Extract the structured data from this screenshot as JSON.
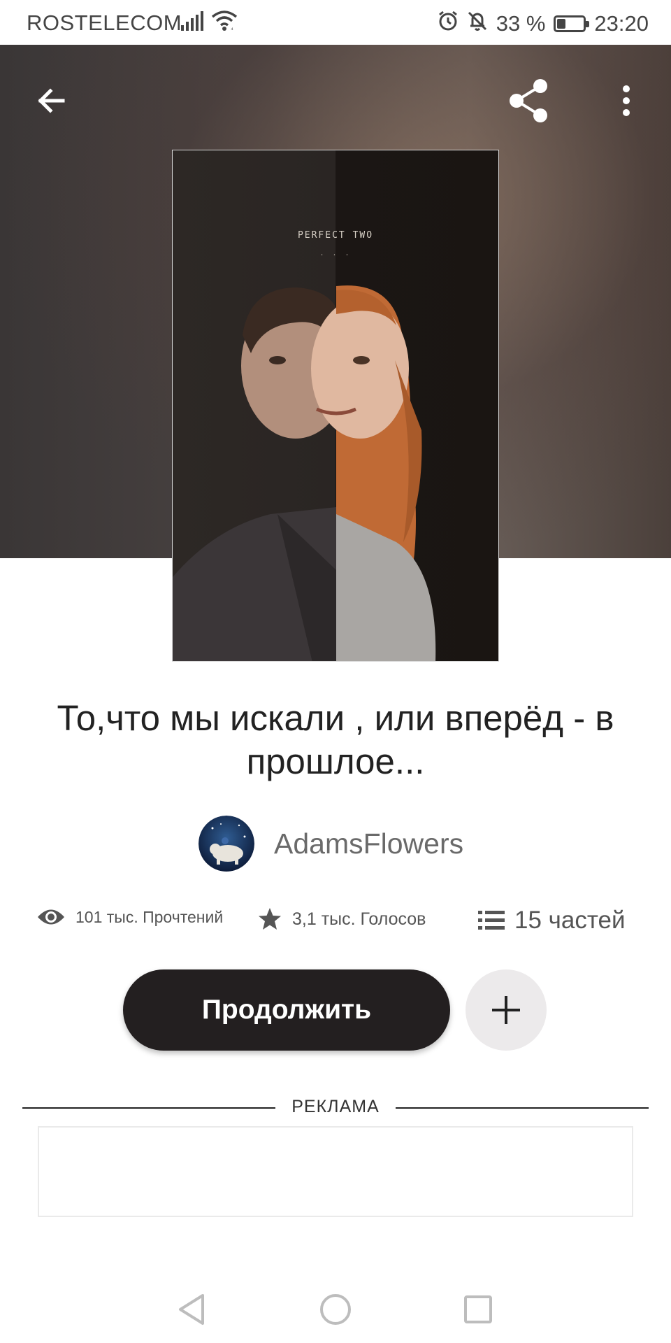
{
  "status_bar": {
    "carrier": "ROSTELECOM",
    "battery_percent": "33 %",
    "battery_level": 0.33,
    "time": "23:20",
    "icons": [
      "signal-icon",
      "wifi-icon",
      "alarm-icon",
      "mute-icon",
      "battery-icon"
    ]
  },
  "header": {
    "icons": [
      "back-arrow-icon",
      "share-icon",
      "more-vert-icon"
    ]
  },
  "cover": {
    "text": "PERFECT TWO",
    "dots": ". . ."
  },
  "story": {
    "title": "То,что мы искали , или вперёд - в прошлое...",
    "author": "AdamsFlowers"
  },
  "stats": {
    "reads": "101 тыс. Прочтений",
    "votes": "3,1 тыс. Голосов",
    "parts": "15 частей"
  },
  "actions": {
    "continue_label": "Продолжить"
  },
  "ad": {
    "label": "РЕКЛАМА"
  },
  "colors": {
    "primary_button": "#231f20",
    "secondary_button": "#eceaeb",
    "text": "#222222",
    "muted": "#6a6a6a"
  }
}
